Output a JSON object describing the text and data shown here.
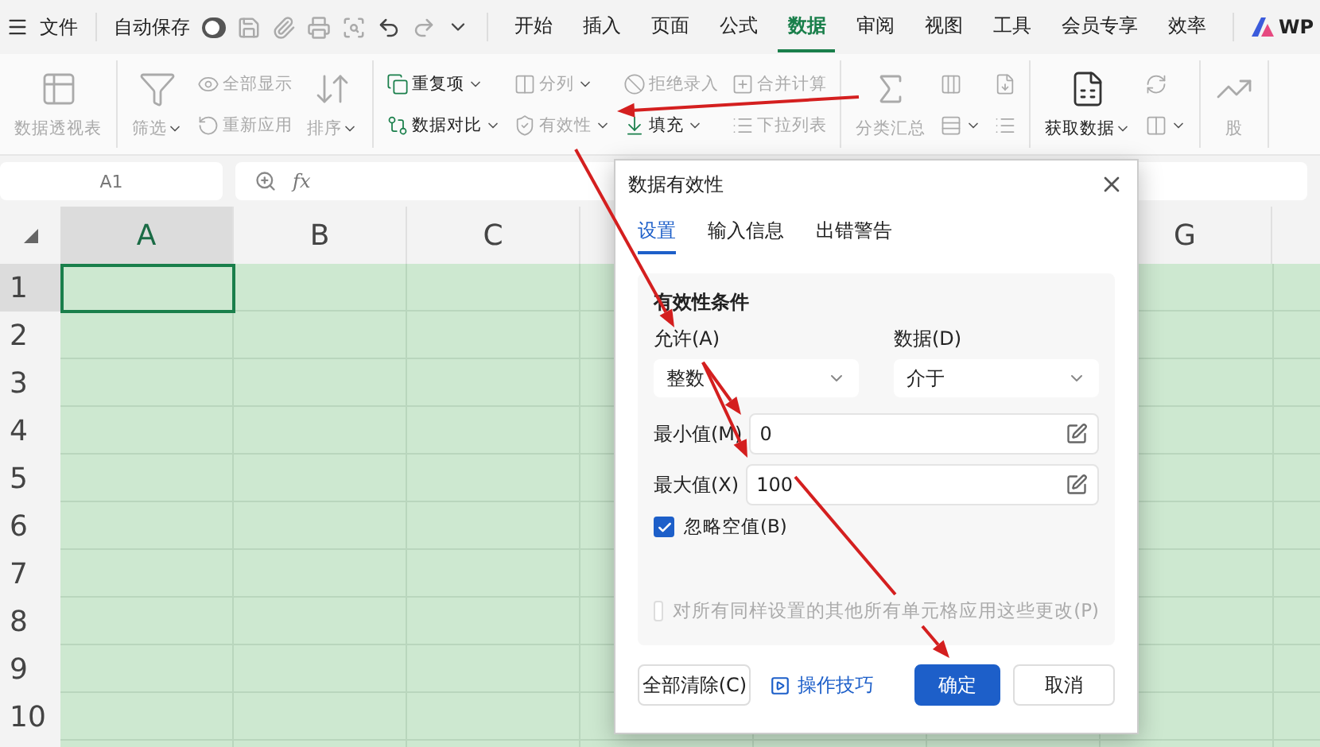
{
  "title_bar": {
    "file_label": "文件",
    "autosave_label": "自动保存",
    "autosave_on": false,
    "tabs": [
      {
        "label": "开始",
        "selected": false
      },
      {
        "label": "插入",
        "selected": false
      },
      {
        "label": "页面",
        "selected": false
      },
      {
        "label": "公式",
        "selected": false
      },
      {
        "label": "数据",
        "selected": true
      },
      {
        "label": "审阅",
        "selected": false
      },
      {
        "label": "视图",
        "selected": false
      },
      {
        "label": "工具",
        "selected": false
      },
      {
        "label": "会员专享",
        "selected": false
      },
      {
        "label": "效率",
        "selected": false
      }
    ],
    "brand": "WP"
  },
  "ribbon": {
    "groups": [
      {
        "columns": [
          [
            {
              "kind": "big",
              "label": "数据透视表",
              "disabled": true,
              "dropdown": false
            }
          ]
        ]
      },
      {
        "columns": [
          [
            {
              "kind": "big",
              "label": "筛选",
              "disabled": true,
              "dropdown": true
            }
          ],
          [
            {
              "kind": "small",
              "label": "全部显示",
              "disabled": true,
              "dropdown": false
            },
            {
              "kind": "small",
              "label": "重新应用",
              "disabled": true,
              "dropdown": false
            }
          ],
          [
            {
              "kind": "big",
              "label": "排序",
              "disabled": true,
              "dropdown": true
            }
          ]
        ]
      },
      {
        "columns": [
          [
            {
              "kind": "small",
              "label": "重复项",
              "disabled": false,
              "dropdown": true
            },
            {
              "kind": "small",
              "label": "数据对比",
              "disabled": false,
              "dropdown": true
            }
          ],
          [
            {
              "kind": "small",
              "label": "分列",
              "disabled": true,
              "dropdown": true
            },
            {
              "kind": "small",
              "label": "有效性",
              "disabled": true,
              "dropdown": true
            }
          ],
          [
            {
              "kind": "small",
              "label": "拒绝录入",
              "disabled": true,
              "dropdown": false
            },
            {
              "kind": "small",
              "label": "填充",
              "disabled": false,
              "dropdown": true
            }
          ],
          [
            {
              "kind": "small",
              "label": "合并计算",
              "disabled": true,
              "dropdown": false
            },
            {
              "kind": "small",
              "label": "下拉列表",
              "disabled": true,
              "dropdown": false
            }
          ]
        ]
      },
      {
        "columns": [
          [
            {
              "kind": "big",
              "label": "分类汇总",
              "disabled": true,
              "dropdown": false
            }
          ],
          [
            {
              "kind": "small",
              "disabled": true,
              "dropdown": false
            },
            {
              "kind": "small",
              "disabled": true,
              "dropdown": true
            }
          ],
          [
            {
              "kind": "small",
              "disabled": true,
              "dropdown": false
            },
            {
              "kind": "small",
              "disabled": true,
              "dropdown": false
            }
          ]
        ]
      },
      {
        "columns": [
          [
            {
              "kind": "big",
              "label": "获取数据",
              "disabled": false,
              "dropdown": true
            }
          ],
          [
            {
              "kind": "small",
              "disabled": true,
              "dropdown": false
            },
            {
              "kind": "small",
              "disabled": true,
              "dropdown": true
            }
          ]
        ]
      },
      {
        "columns": [
          [
            {
              "kind": "big",
              "label": "股",
              "disabled": true,
              "dropdown": false
            }
          ]
        ]
      }
    ]
  },
  "formula_bar": {
    "name_box": "A1",
    "fx_label": "fx"
  },
  "grid": {
    "columns": [
      {
        "label": "A",
        "selected": true
      },
      {
        "label": "B",
        "selected": false
      },
      {
        "label": "C",
        "selected": false
      },
      {
        "label": "G",
        "selected": false
      }
    ],
    "rows": [
      {
        "label": "1",
        "selected": true
      },
      {
        "label": "2",
        "selected": false
      },
      {
        "label": "3",
        "selected": false
      },
      {
        "label": "4",
        "selected": false
      },
      {
        "label": "5",
        "selected": false
      },
      {
        "label": "6",
        "selected": false
      },
      {
        "label": "7",
        "selected": false
      },
      {
        "label": "8",
        "selected": false
      },
      {
        "label": "9",
        "selected": false
      },
      {
        "label": "10",
        "selected": false
      }
    ]
  },
  "dialog": {
    "title": "数据有效性",
    "tabs": [
      {
        "label": "设置",
        "selected": true
      },
      {
        "label": "输入信息",
        "selected": false
      },
      {
        "label": "出错警告",
        "selected": false
      }
    ],
    "section_title": "有效性条件",
    "allow": {
      "label": "允许(A)",
      "value": "整数"
    },
    "data": {
      "label": "数据(D)",
      "value": "介于"
    },
    "min": {
      "label": "最小值(M)",
      "value": "0"
    },
    "max": {
      "label": "最大值(X)",
      "value": "100"
    },
    "ignore_blank": {
      "label": "忽略空值(B)",
      "checked": true
    },
    "apply_all": {
      "label": "对所有同样设置的其他所有单元格应用这些更改(P)",
      "checked": false,
      "disabled": true
    },
    "buttons": [
      {
        "label": "全部清除(C)",
        "kind": "default"
      },
      {
        "label": "操作技巧",
        "kind": "link"
      },
      {
        "label": "确定",
        "kind": "primary"
      },
      {
        "label": "取消",
        "kind": "default"
      }
    ]
  }
}
